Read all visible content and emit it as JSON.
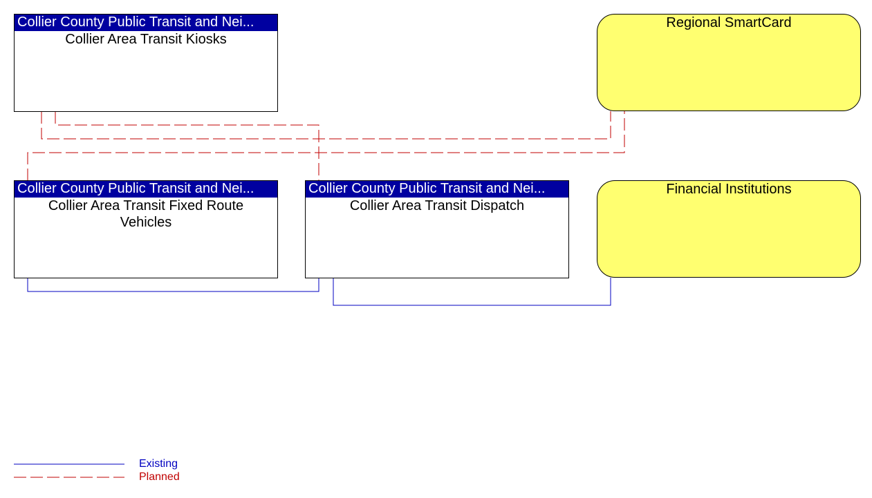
{
  "colors": {
    "existing": "#0000c0",
    "planned": "#c00000",
    "header": "#0000a0",
    "external": "#ffff70"
  },
  "nodes": {
    "kiosks": {
      "header": "Collier County Public Transit and Nei...",
      "name": "Collier Area Transit Kiosks"
    },
    "fixed_route": {
      "header": "Collier County Public Transit and Nei...",
      "name": "Collier Area Transit Fixed Route Vehicles"
    },
    "dispatch": {
      "header": "Collier County Public Transit and Nei...",
      "name": "Collier Area Transit Dispatch"
    },
    "smartcard": {
      "name": "Regional SmartCard"
    },
    "financial": {
      "name": "Financial Institutions"
    }
  },
  "flows": [
    {
      "from": "kiosks",
      "to": "dispatch",
      "status": "planned"
    },
    {
      "from": "kiosks",
      "to": "smartcard",
      "status": "planned"
    },
    {
      "from": "fixed_route",
      "to": "smartcard",
      "status": "planned"
    },
    {
      "from": "fixed_route",
      "to": "dispatch",
      "status": "existing"
    },
    {
      "from": "dispatch",
      "to": "financial",
      "status": "existing"
    }
  ],
  "legend": {
    "existing": "Existing",
    "planned": "Planned"
  }
}
